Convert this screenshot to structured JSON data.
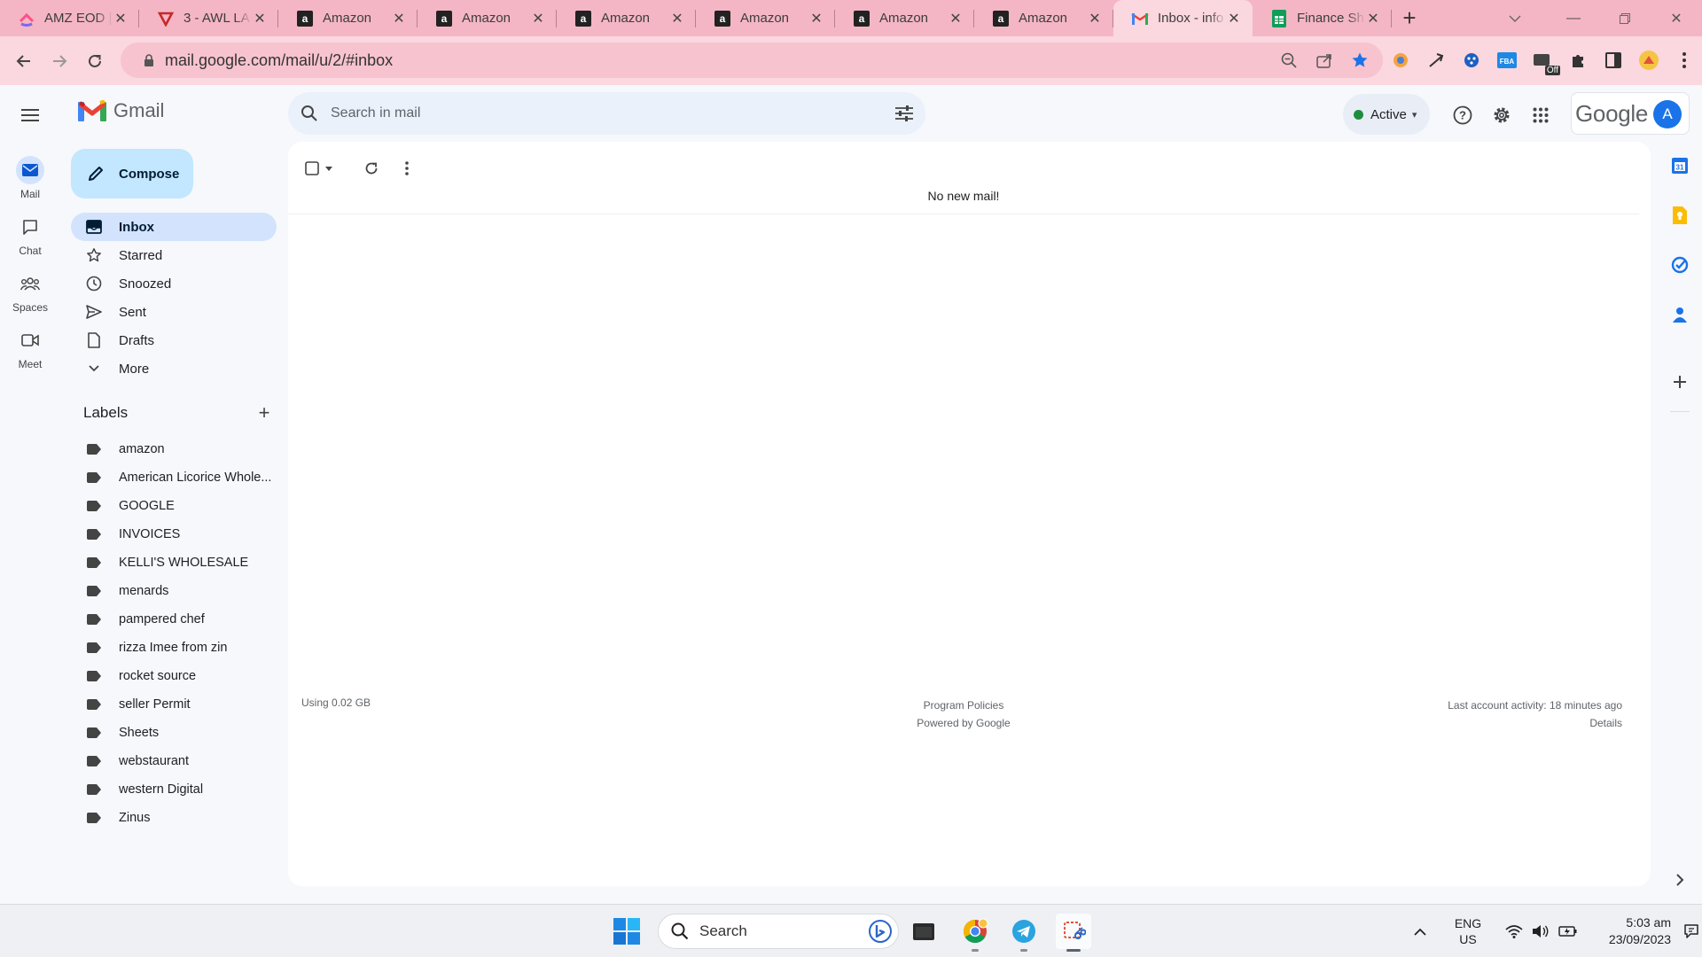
{
  "browser": {
    "tabs": [
      {
        "label": "AMZ EOD | ",
        "icon": "clickup-icon",
        "active": false
      },
      {
        "label": "3 - AWL LA",
        "icon": "todoist-icon",
        "active": false
      },
      {
        "label": "Amazon",
        "icon": "amazon-icon",
        "active": false
      },
      {
        "label": "Amazon",
        "icon": "amazon-icon",
        "active": false
      },
      {
        "label": "Amazon",
        "icon": "amazon-icon",
        "active": false
      },
      {
        "label": "Amazon",
        "icon": "amazon-icon",
        "active": false
      },
      {
        "label": "Amazon",
        "icon": "amazon-icon",
        "active": false
      },
      {
        "label": "Amazon",
        "icon": "amazon-icon",
        "active": false
      },
      {
        "label": "Inbox - info",
        "icon": "gmail-icon",
        "active": true
      },
      {
        "label": "Finance Sh",
        "icon": "sheets-icon",
        "active": false
      }
    ],
    "url": "mail.google.com/mail/u/2/#inbox",
    "extension_badge": "Off",
    "colors": {
      "tabstrip": "#f4b6c4",
      "toolbar": "#fbd7df",
      "accent": "#1a73e8"
    }
  },
  "gmail": {
    "app_name": "Gmail",
    "search_placeholder": "Search in mail",
    "status": "Active",
    "account_brand": "Google",
    "account_initial": "A",
    "compose_label": "Compose",
    "rail": [
      {
        "label": "Mail",
        "icon": "mail-icon"
      },
      {
        "label": "Chat",
        "icon": "chat-icon"
      },
      {
        "label": "Spaces",
        "icon": "spaces-icon"
      },
      {
        "label": "Meet",
        "icon": "meet-icon"
      }
    ],
    "nav": [
      {
        "label": "Inbox",
        "icon": "inbox-icon"
      },
      {
        "label": "Starred",
        "icon": "star-icon"
      },
      {
        "label": "Snoozed",
        "icon": "clock-icon"
      },
      {
        "label": "Sent",
        "icon": "send-icon"
      },
      {
        "label": "Drafts",
        "icon": "draft-icon"
      },
      {
        "label": "More",
        "icon": "chevron-down-icon"
      }
    ],
    "labels_title": "Labels",
    "labels": [
      "amazon",
      "American Licorice Whole...",
      "GOOGLE",
      "INVOICES",
      "KELLI'S WHOLESALE",
      "menards",
      "pampered chef",
      "rizza Imee from zin",
      "rocket source",
      "seller Permit",
      "Sheets",
      "webstaurant",
      "western Digital",
      "Zinus"
    ],
    "empty_message": "No new mail!",
    "footer": {
      "storage": "Using 0.02 GB",
      "policies": "Program Policies",
      "powered": "Powered by Google",
      "activity": "Last account activity: 18 minutes ago",
      "details": "Details"
    }
  },
  "taskbar": {
    "search_label": "Search",
    "lang": "ENG",
    "region": "US",
    "time": "5:03 am",
    "date": "23/09/2023"
  }
}
